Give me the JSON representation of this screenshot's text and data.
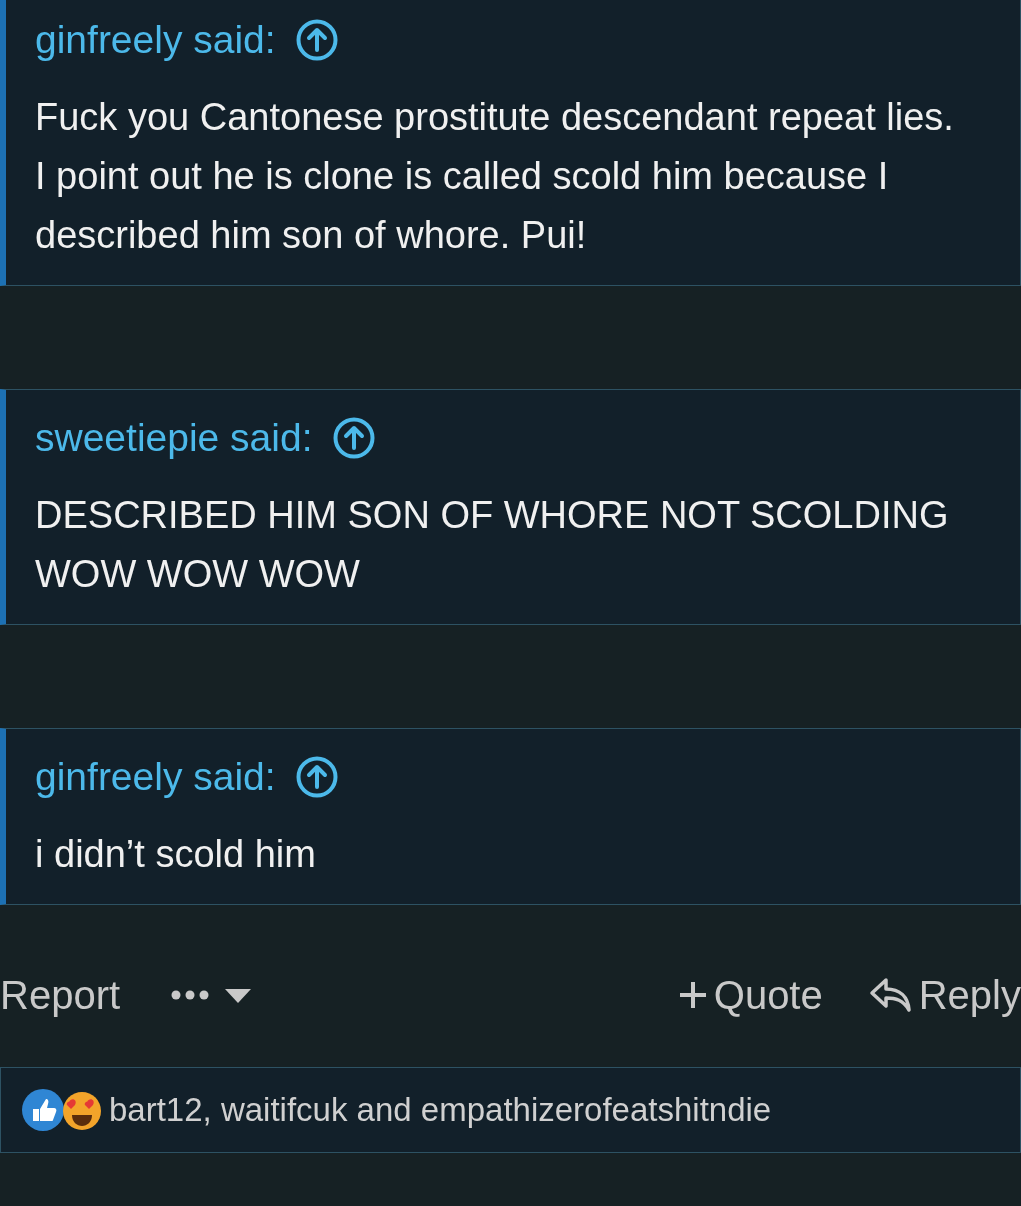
{
  "quotes": [
    {
      "author": "ginfreely said:",
      "lines": [
        "Fuck you Cantonese prostitute descendant repeat lies. I point out he is clone is called scold him because I described him son of whore. Pui!"
      ],
      "cut_top": true
    },
    {
      "author": "sweetiepie said:",
      "lines": [
        "DESCRIBED HIM SON OF WHORE NOT SCOLDING WOW WOW WOW"
      ],
      "cut_top": false
    },
    {
      "author": "ginfreely said:",
      "lines": [
        "i didn’t scold him"
      ],
      "cut_top": false
    }
  ],
  "actions": {
    "report": "Report",
    "quote": "Quote",
    "reply": "Reply"
  },
  "reactions": {
    "users": "bart12, waitifcuk and empathizerofeatshitndie"
  }
}
